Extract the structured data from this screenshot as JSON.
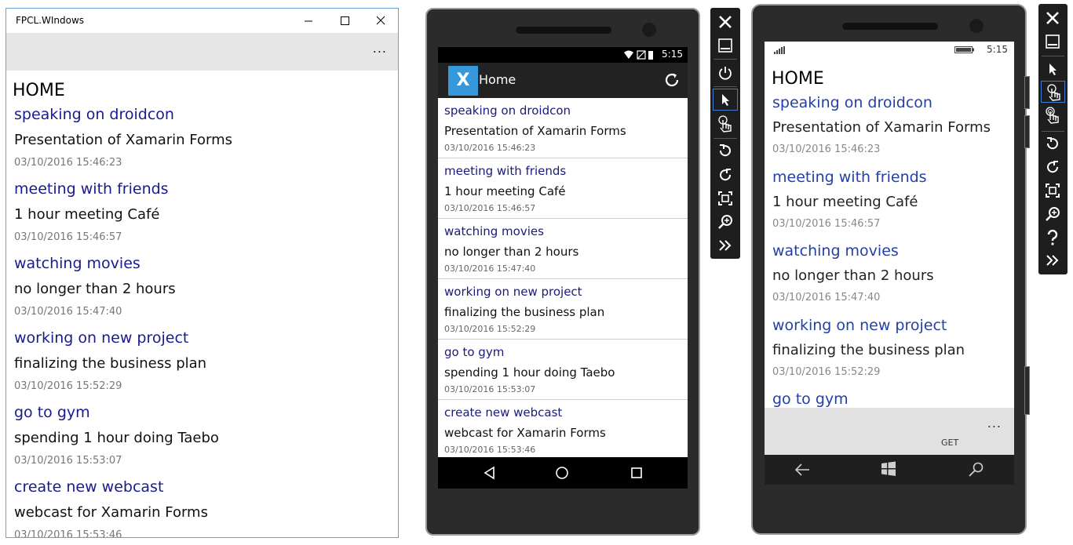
{
  "windows_app": {
    "title": "FPCL.WIndows",
    "more_label": "...",
    "page_title": "HOME",
    "items": [
      {
        "title": "speaking on droidcon",
        "desc": "Presentation of Xamarin Forms",
        "date": "03/10/2016 15:46:23"
      },
      {
        "title": "meeting with friends",
        "desc": "1 hour meeting Café",
        "date": "03/10/2016 15:46:57"
      },
      {
        "title": "watching movies",
        "desc": "no longer than 2 hours",
        "date": "03/10/2016 15:47:40"
      },
      {
        "title": "working on new project",
        "desc": "finalizing the business plan",
        "date": "03/10/2016 15:52:29"
      },
      {
        "title": "go to gym",
        "desc": "spending 1 hour doing Taebo",
        "date": "03/10/2016 15:53:07"
      },
      {
        "title": "create new webcast",
        "desc": "webcast for Xamarin Forms",
        "date": "03/10/2016 15:53:46"
      }
    ]
  },
  "android": {
    "status_time": "5:15",
    "logo_letter": "X",
    "app_title": "Home",
    "items": [
      {
        "title": "speaking on droidcon",
        "desc": "Presentation of Xamarin Forms",
        "date": "03/10/2016 15:46:23"
      },
      {
        "title": "meeting with friends",
        "desc": "1 hour meeting Café",
        "date": "03/10/2016 15:46:57"
      },
      {
        "title": "watching movies",
        "desc": "no longer than 2 hours",
        "date": "03/10/2016 15:47:40"
      },
      {
        "title": "working on new project",
        "desc": "finalizing the business plan",
        "date": "03/10/2016 15:52:29"
      },
      {
        "title": "go to gym",
        "desc": "spending 1 hour doing Taebo",
        "date": "03/10/2016 15:53:07"
      },
      {
        "title": "create new webcast",
        "desc": "webcast for Xamarin Forms",
        "date": "03/10/2016 15:53:46"
      }
    ]
  },
  "winphone": {
    "status_time": "5:15",
    "page_title": "HOME",
    "items": [
      {
        "title": "speaking on droidcon",
        "desc": "Presentation of Xamarin Forms",
        "date": "03/10/2016 15:46:23"
      },
      {
        "title": "meeting with friends",
        "desc": "1 hour meeting Café",
        "date": "03/10/2016 15:46:57"
      },
      {
        "title": "watching movies",
        "desc": "no longer than 2 hours",
        "date": "03/10/2016 15:47:40"
      },
      {
        "title": "working on new project",
        "desc": "finalizing the business plan",
        "date": "03/10/2016 15:52:29"
      },
      {
        "title": "go to gym",
        "desc": "",
        "date": ""
      }
    ],
    "more_label": "...",
    "appbar_button_label": "GET"
  },
  "icons": {
    "windows_titlebar": [
      "minimize-icon",
      "maximize-icon",
      "close-icon"
    ],
    "android_nav": [
      "back-triangle-icon",
      "home-circle-icon",
      "recents-square-icon"
    ],
    "winphone_nav": [
      "back-arrow-icon",
      "windows-logo-icon",
      "search-icon"
    ],
    "emulator_toolbar_1": [
      "close-icon",
      "minimize-icon",
      "power-icon",
      "pointer-icon",
      "single-touch-icon",
      "rotate-left-icon",
      "rotate-right-icon",
      "fit-screen-icon",
      "zoom-icon",
      "more-tools-icon"
    ],
    "emulator_toolbar_2": [
      "close-icon",
      "minimize-icon",
      "pointer-icon",
      "single-touch-icon",
      "multi-touch-icon",
      "rotate-left-icon",
      "rotate-right-icon",
      "fit-screen-icon",
      "zoom-icon",
      "help-icon",
      "more-tools-icon"
    ]
  },
  "colors": {
    "windows_item_title": "#1a1a8f",
    "android_item_title": "#1a1a7a",
    "winphone_item_title": "#2440a6",
    "xamarin_blue": "#3498db",
    "window_border": "#6b9fd6"
  }
}
